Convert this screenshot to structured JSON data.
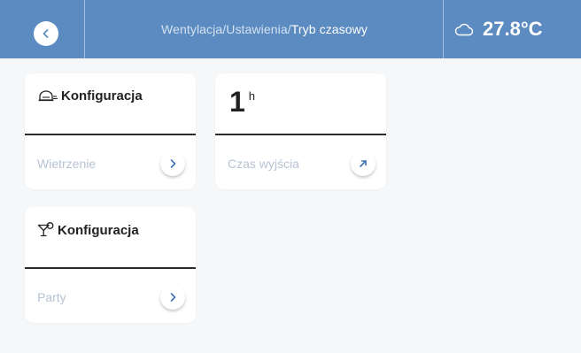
{
  "header": {
    "breadcrumb": [
      "Wentylacja",
      "Ustawienia",
      "Tryb czasowy"
    ],
    "separator": "/",
    "weather_icon": "cloud-icon",
    "temperature": "27.8°C"
  },
  "cards": {
    "ventilation": {
      "icon": "ventilation-icon",
      "title": "Konfiguracja",
      "footer_label": "Wietrzenie",
      "action_icon": "chevron-right-icon"
    },
    "time": {
      "value": "1",
      "unit": "h",
      "footer_label": "Czas wyjścia",
      "action_icon": "arrow-up-right-icon"
    },
    "party": {
      "icon": "cocktail-icon",
      "title": "Konfiguracja",
      "footer_label": "Party",
      "action_icon": "chevron-right-icon"
    }
  },
  "colors": {
    "header_bg": "#5b8bc0",
    "page_bg": "#f6f7f9",
    "card_bg": "#ffffff",
    "accent": "#3f72b0",
    "muted_text": "#b6c3d2"
  }
}
